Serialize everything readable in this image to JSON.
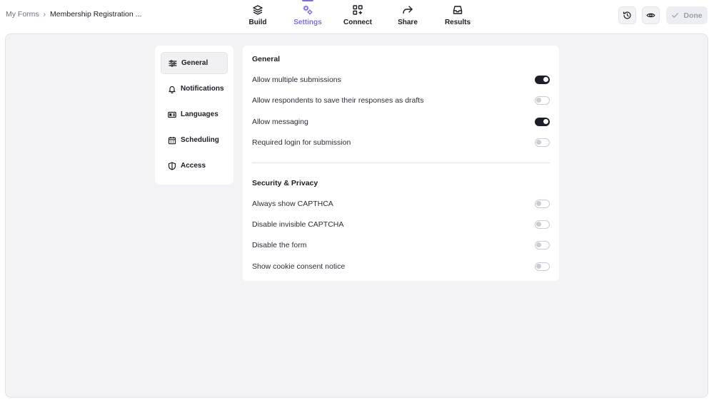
{
  "breadcrumb": {
    "root": "My Forms",
    "separator": "›",
    "current": "Membership Registration ..."
  },
  "nav": {
    "tabs": [
      {
        "label": "Build",
        "icon": "layers-icon",
        "active": false
      },
      {
        "label": "Settings",
        "icon": "gears-icon",
        "active": true
      },
      {
        "label": "Connect",
        "icon": "apps-plus-icon",
        "active": false
      },
      {
        "label": "Share",
        "icon": "share-arrow-icon",
        "active": false
      },
      {
        "label": "Results",
        "icon": "inbox-icon",
        "active": false
      }
    ]
  },
  "actions": {
    "history_icon": "history-icon",
    "preview_icon": "eye-icon",
    "done_label": "Done",
    "done_icon": "check-icon"
  },
  "sidemenu": {
    "items": [
      {
        "label": "General",
        "icon": "sliders-icon",
        "active": true
      },
      {
        "label": "Notifications",
        "icon": "bell-icon",
        "active": false
      },
      {
        "label": "Languages",
        "icon": "language-icon",
        "active": false
      },
      {
        "label": "Scheduling",
        "icon": "calendar-icon",
        "active": false
      },
      {
        "label": "Access",
        "icon": "shield-icon",
        "active": false
      }
    ]
  },
  "settings": {
    "general": {
      "title": "General",
      "rows": [
        {
          "label": "Allow multiple submissions",
          "on": true
        },
        {
          "label": "Allow respondents to save their responses as drafts",
          "on": false
        },
        {
          "label": "Allow messaging",
          "on": true
        },
        {
          "label": "Required login for submission",
          "on": false
        }
      ]
    },
    "security": {
      "title": "Security & Privacy",
      "rows": [
        {
          "label": "Always show CAPTHCA",
          "on": false
        },
        {
          "label": "Disable invisible CAPTCHA",
          "on": false
        },
        {
          "label": "Disable the form",
          "on": false
        },
        {
          "label": "Show cookie consent notice",
          "on": false
        }
      ]
    }
  },
  "colors": {
    "accent": "#7c6fe0",
    "toggle_on": "#1b1d2a",
    "toggle_off": "#c9ccd3",
    "canvas": "#f3f3f6"
  }
}
